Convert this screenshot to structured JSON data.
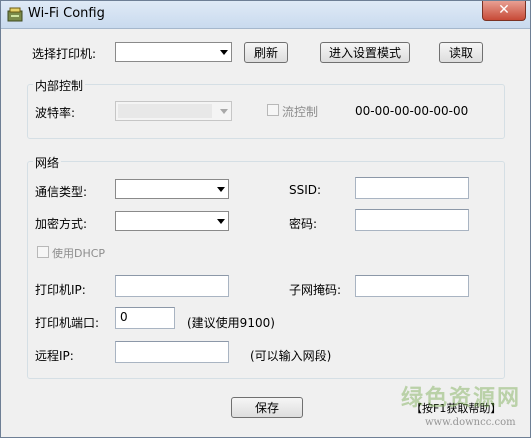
{
  "window": {
    "title": "Wi-Fi Config",
    "close_label": "✕"
  },
  "top": {
    "printer_label": "选择打印机:",
    "printer_value": "",
    "refresh_label": "刷新",
    "setup_mode_label": "进入设置模式",
    "read_label": "读取"
  },
  "internal": {
    "group_title": "内部控制",
    "baud_label": "波特率:",
    "baud_value": "",
    "flow_label": "流控制",
    "mac_value": "00-00-00-00-00-00"
  },
  "network": {
    "group_title": "网络",
    "comm_type_label": "通信类型:",
    "comm_type_value": "",
    "encryption_label": "加密方式:",
    "encryption_value": "",
    "ssid_label": "SSID:",
    "ssid_value": "",
    "password_label": "密码:",
    "password_value": "",
    "dhcp_label": "使用DHCP",
    "printer_ip_label": "打印机IP:",
    "printer_ip_value": "",
    "subnet_label": "子网掩码:",
    "subnet_value": "",
    "port_label": "打印机端口:",
    "port_value": "0",
    "port_hint": "(建议使用9100)",
    "remote_ip_label": "远程IP:",
    "remote_ip_value": "",
    "remote_ip_hint": "(可以输入网段)"
  },
  "footer": {
    "save_label": "保存",
    "help_label": "【按F1获取帮助】"
  },
  "watermark": {
    "text": "绿色资源网",
    "url": "www.downcc.com"
  }
}
